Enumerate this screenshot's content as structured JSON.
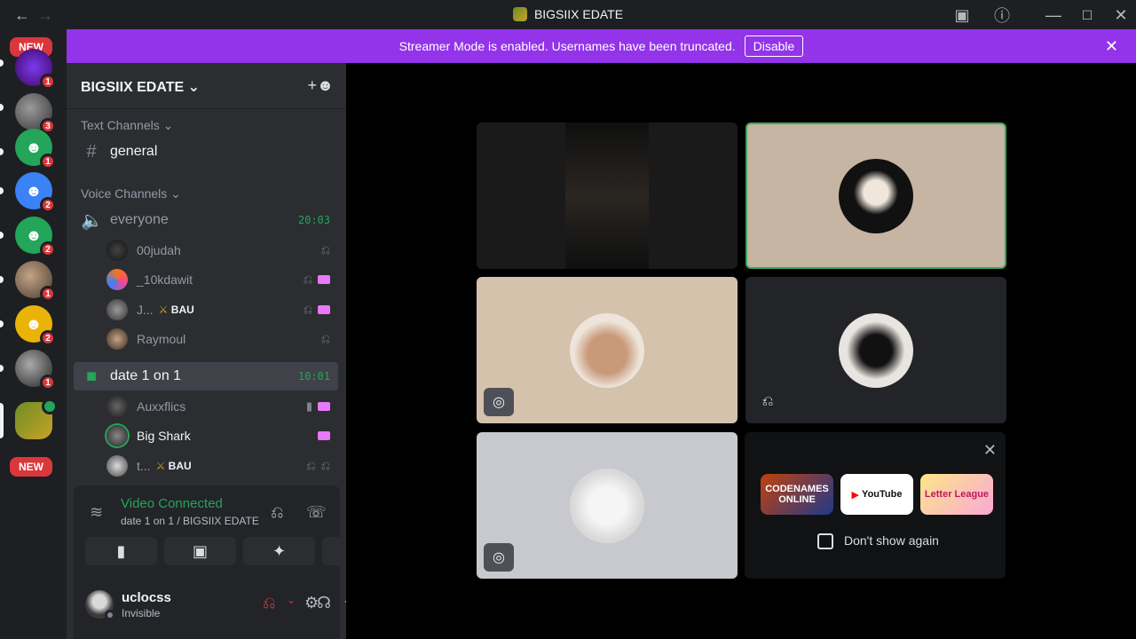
{
  "window": {
    "title": "BIGSIIX EDATE"
  },
  "banner": {
    "message": "Streamer Mode is enabled. Usernames have been truncated.",
    "button_label": "Disable"
  },
  "rail": {
    "new_label": "NEW",
    "servers": [
      {
        "badge": "1",
        "color": "#7c3aed"
      },
      {
        "badge": "3",
        "color": "#555555"
      },
      {
        "badge": "1",
        "color": "#23a55a"
      },
      {
        "badge": "2",
        "color": "#3b82f6"
      },
      {
        "badge": "2",
        "color": "#23a55a"
      },
      {
        "badge": "1",
        "color": "#8a6a55"
      },
      {
        "badge": "2",
        "color": "#eab308"
      },
      {
        "badge": "1",
        "color": "#666666"
      }
    ]
  },
  "guild": {
    "name": "BIGSIIX EDATE"
  },
  "sidebar": {
    "text_category": "Text Channels",
    "voice_category": "Voice Channels",
    "text_channel": "general",
    "voice_channel_1": {
      "name": "everyone",
      "timer": "20:03"
    },
    "voice_channel_2": {
      "name": "date 1 on 1",
      "timer": "10:01"
    },
    "users_vc1": [
      {
        "name": "00judah",
        "role": "",
        "icons": "mute"
      },
      {
        "name": "_10kdawit",
        "role": "",
        "icons": "mute-stream"
      },
      {
        "name": "J...",
        "role": "BAU",
        "icons": "mute-stream"
      },
      {
        "name": "Raymoul",
        "role": "",
        "icons": "mute"
      }
    ],
    "users_vc2": [
      {
        "name": "Auxxflics",
        "role": "",
        "icons": "video-stream"
      },
      {
        "name": "Big Shark",
        "role": "",
        "icons": "stream"
      },
      {
        "name": "t...",
        "role": "BAU",
        "icons": "mute-deaf"
      }
    ]
  },
  "voice_panel": {
    "status": "Video Connected",
    "location": "date 1 on 1 / BIGSIIX EDATE"
  },
  "user_panel": {
    "username": "uclocss",
    "status": "Invisible"
  },
  "activities": {
    "cards": [
      "CODENAMES ONLINE",
      "YouTube",
      "Letter League"
    ],
    "dont_show_label": "Don't show again"
  },
  "colors": {
    "accent_banner": "#9333ea",
    "speaking_border": "#3ba55c",
    "connected_green": "#23a55a",
    "badge_red": "#da373c"
  }
}
